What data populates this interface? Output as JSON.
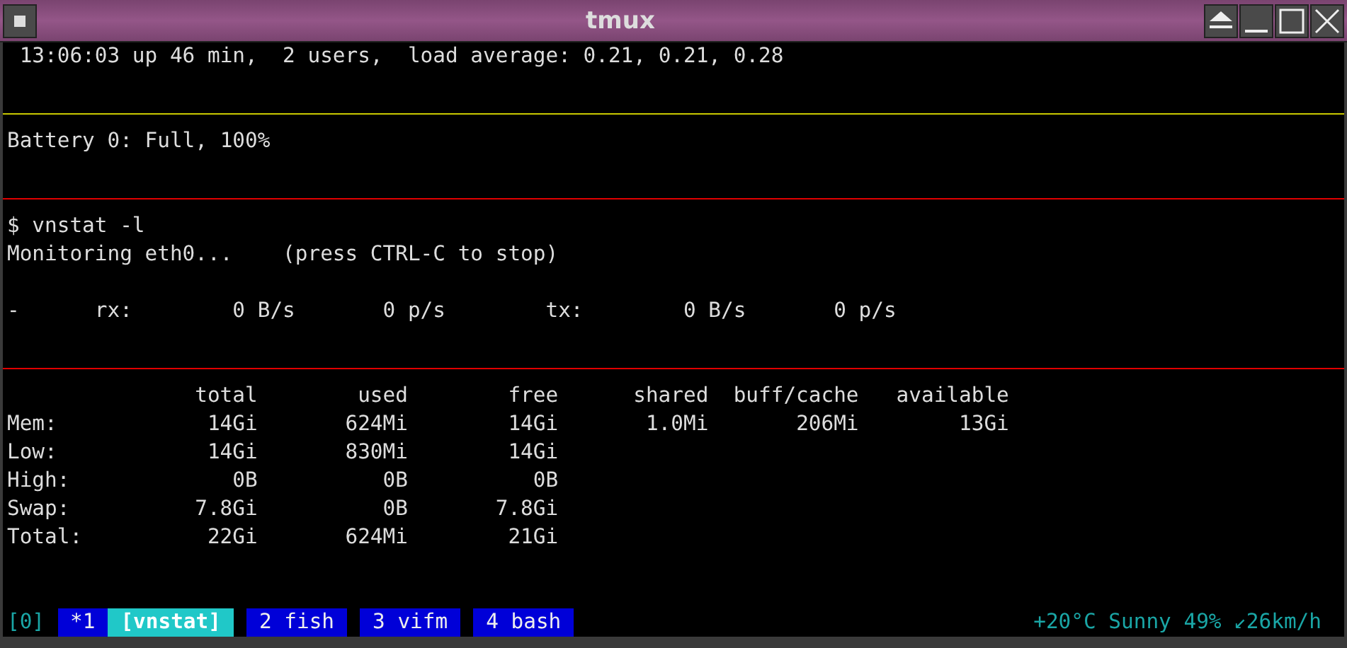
{
  "window": {
    "title": "tmux"
  },
  "panes": [
    {
      "color": "#c8c800",
      "lines": [
        {
          "kind": "output",
          "text": " 13:06:03 up 46 min,  2 users,  load average: 0.21, 0.21, 0.28"
        }
      ]
    },
    {
      "color": "#e00000",
      "lines": [
        {
          "kind": "output",
          "text": "Battery 0: Full, 100%"
        }
      ]
    },
    {
      "color": "#e00000",
      "lines": [
        {
          "kind": "prompt",
          "text": "$ vnstat -l"
        },
        {
          "kind": "output",
          "text": "Monitoring eth0...    (press CTRL-C to stop)"
        },
        {
          "kind": "rate",
          "text": "-      rx:        0 B/s       0 p/s        tx:        0 B/s       0 p/s"
        }
      ]
    }
  ],
  "memory": {
    "columns": [
      "total",
      "used",
      "free",
      "shared",
      "buff/cache",
      "available"
    ],
    "rows": [
      {
        "label": "Mem:",
        "cells": [
          "14Gi",
          "624Mi",
          "14Gi",
          "1.0Mi",
          "206Mi",
          "13Gi"
        ]
      },
      {
        "label": "Low:",
        "cells": [
          "14Gi",
          "830Mi",
          "14Gi"
        ]
      },
      {
        "label": "High:",
        "cells": [
          "0B",
          "0B",
          "0B"
        ]
      },
      {
        "label": "Swap:",
        "cells": [
          "7.8Gi",
          "0B",
          "7.8Gi"
        ]
      },
      {
        "label": "Total:",
        "cells": [
          "22Gi",
          "624Mi",
          "21Gi"
        ]
      }
    ]
  },
  "status_bar": {
    "session": "[0]",
    "windows": [
      {
        "index": "*1",
        "name": "[vnstat]",
        "selected": true
      },
      {
        "index": "2",
        "name": "fish",
        "selected": false
      },
      {
        "index": "3",
        "name": "vifm",
        "selected": false
      },
      {
        "index": "4",
        "name": "bash",
        "selected": false
      }
    ],
    "right": "+20°C Sunny 49% ↙26km/h"
  }
}
